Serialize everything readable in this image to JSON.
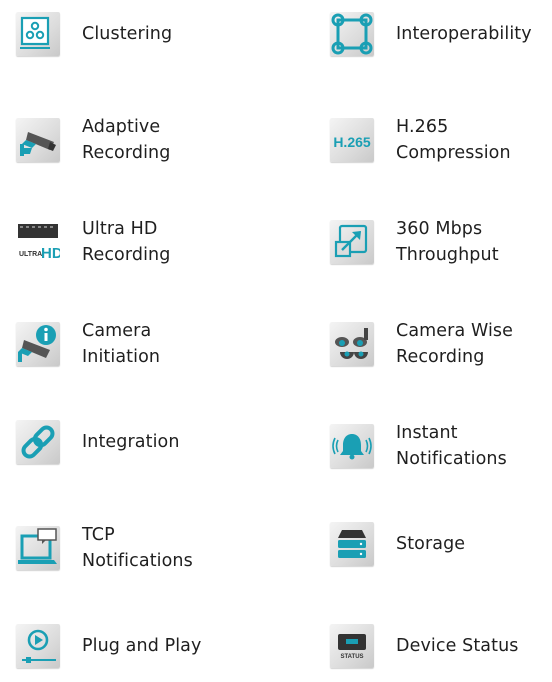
{
  "features": [
    {
      "label": "Clustering",
      "icon": "clustering-icon"
    },
    {
      "label": "Interoperability",
      "icon": "interoperability-icon"
    },
    {
      "label": "Adaptive\nRecording",
      "icon": "cctv-camera-icon"
    },
    {
      "label": "H.265\nCompression",
      "icon": "h265-icon",
      "icon_text": "H.265"
    },
    {
      "label": "Ultra HD\nRecording",
      "icon": "ultra-hd-icon",
      "icon_text_small": "ULTRA",
      "icon_text_big": "HD"
    },
    {
      "label": "360 Mbps\nThroughput",
      "icon": "throughput-arrow-icon"
    },
    {
      "label": "Camera\nInitiation",
      "icon": "camera-info-icon"
    },
    {
      "label": "Camera Wise\nRecording",
      "icon": "multi-camera-icon"
    },
    {
      "label": "Integration",
      "icon": "link-icon"
    },
    {
      "label": "Instant\nNotifications",
      "icon": "bell-icon"
    },
    {
      "label": "TCP\nNotifications",
      "icon": "laptop-message-icon"
    },
    {
      "label": "Storage",
      "icon": "storage-stack-icon"
    },
    {
      "label": "Plug and Play",
      "icon": "play-slider-icon"
    },
    {
      "label": "Device Status",
      "icon": "device-status-icon",
      "icon_text": "STATUS"
    }
  ],
  "colors": {
    "accent": "#1a9fb4",
    "text": "#1f1f1f",
    "icon_bg": "#dcdcdc"
  }
}
